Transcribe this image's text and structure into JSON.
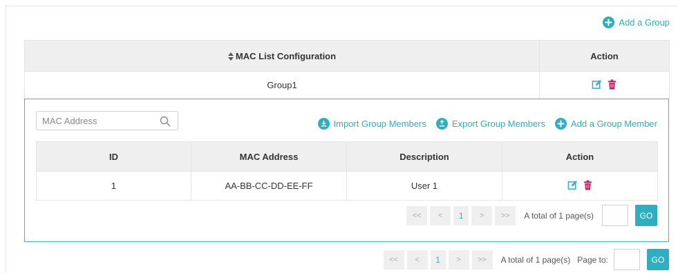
{
  "outer": {
    "add_group_label": "Add a Group",
    "columns": [
      "MAC List Configuration",
      "Action"
    ],
    "rows": [
      {
        "name": "Group1"
      }
    ]
  },
  "sub": {
    "search": {
      "placeholder": "MAC Address",
      "value": ""
    },
    "actions": {
      "import_label": "Import Group Members",
      "export_label": "Export Group Members",
      "add_member_label": "Add a Group Member"
    },
    "columns": [
      "ID",
      "MAC Address",
      "Description",
      "Action"
    ],
    "rows": [
      {
        "id": "1",
        "mac": "AA-BB-CC-DD-EE-FF",
        "description": "User 1"
      }
    ],
    "pager": {
      "first": "<<",
      "prev": "<",
      "page": "1",
      "next": ">",
      "last": ">>",
      "total_text": "A total of 1 page(s)",
      "go_label": "GO"
    }
  },
  "pager": {
    "first": "<<",
    "prev": "<",
    "page": "1",
    "next": ">",
    "last": ">>",
    "total_text": "A total of 1 page(s)",
    "page_to_label": "Page to:",
    "go_label": "GO"
  },
  "colors": {
    "accent": "#2bb0c2",
    "delete": "#c2185b",
    "header_bg": "#efefef",
    "border": "#e4e4e4"
  },
  "icons": [
    "plus-circle-icon",
    "sort-icon",
    "edit-icon",
    "delete-icon",
    "search-icon",
    "import-icon",
    "export-icon"
  ]
}
